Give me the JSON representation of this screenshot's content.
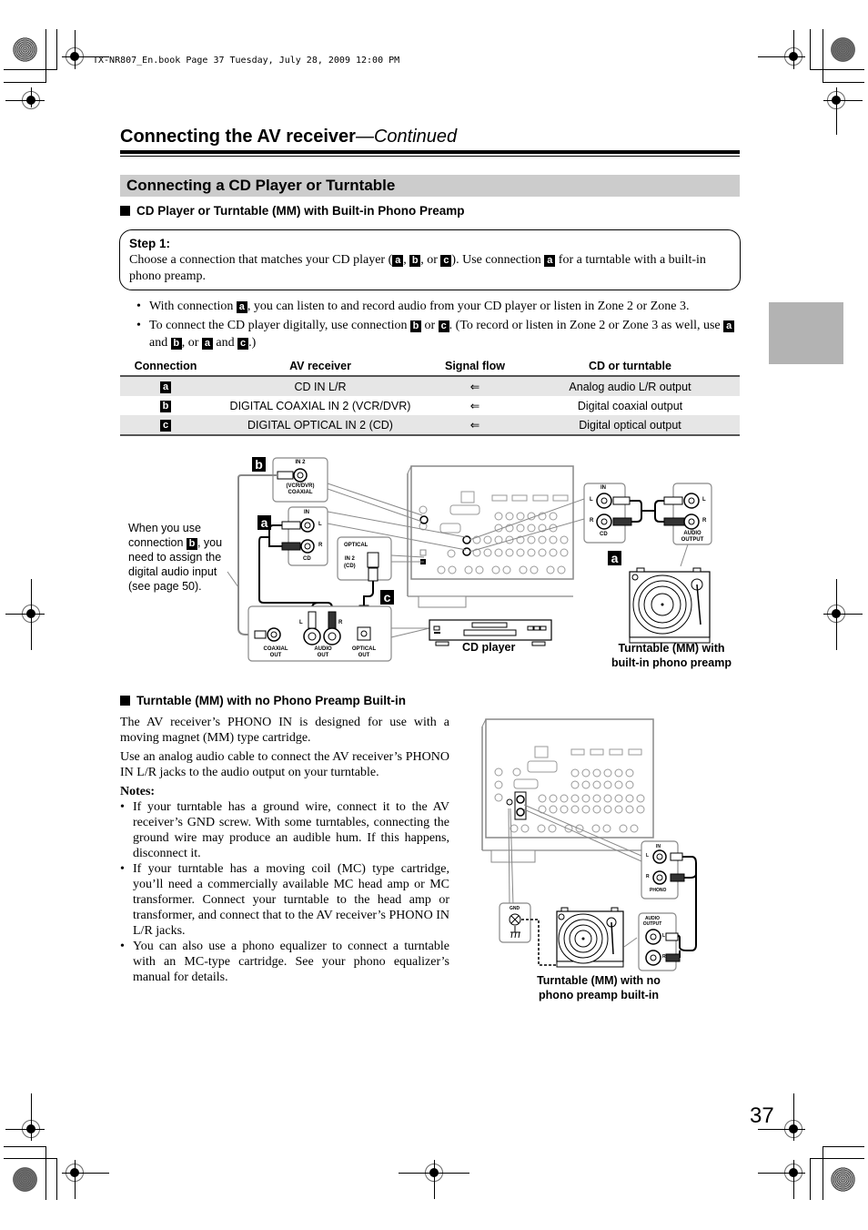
{
  "print_header": "TX-NR807_En.book  Page 37  Tuesday, July 28, 2009  12:00 PM",
  "page_title": {
    "main": "Connecting the AV receiver",
    "suffix": "—Continued"
  },
  "section_title": "Connecting a CD Player or Turntable",
  "subsection1": {
    "heading": "CD Player or Turntable (MM) with Built-in Phono Preamp",
    "step": {
      "label": "Step 1:",
      "text_parts": [
        "Choose a connection that matches your CD player (",
        ", ",
        ", or ",
        "). Use connection ",
        " for a turntable with a built-in phono preamp."
      ],
      "badges": [
        "a",
        "b",
        "c",
        "a"
      ]
    },
    "bullets": [
      {
        "parts": [
          "With connection ",
          ", you can listen to and record audio from your CD player or listen in Zone 2 or Zone 3."
        ],
        "badges": [
          "a"
        ]
      },
      {
        "parts": [
          "To connect the CD player digitally, use connection ",
          " or ",
          ". (To record or listen in Zone 2 or Zone 3 as well, use ",
          " and ",
          ", or ",
          " and ",
          ".)"
        ],
        "badges": [
          "b",
          "c",
          "a",
          "b",
          "a",
          "c"
        ]
      }
    ],
    "table": {
      "headers": [
        "Connection",
        "AV receiver",
        "Signal flow",
        "CD or turntable"
      ],
      "rows": [
        {
          "connection": "a",
          "receiver": "CD IN L/R",
          "flow": "⇐",
          "device": "Analog audio L/R output"
        },
        {
          "connection": "b",
          "receiver": "DIGITAL COAXIAL IN 2 (VCR/DVR)",
          "flow": "⇐",
          "device": "Digital coaxial output"
        },
        {
          "connection": "c",
          "receiver": "DIGITAL OPTICAL IN 2 (CD)",
          "flow": "⇐",
          "device": "Digital optical output"
        }
      ]
    },
    "diagram": {
      "callout": [
        "When you use",
        "connection ",
        ", you",
        "need to assign the",
        "digital audio input",
        "(see page 50)."
      ],
      "callout_badge": "b",
      "badges": {
        "b": "b",
        "a": "a",
        "c": "c",
        "a2": "a"
      },
      "coax_in_label1": "IN 2",
      "coax_in_label2": "(VCR/DVR)",
      "coax_in_label3": "COAXIAL",
      "cd_in_top": "IN",
      "cd_in_bottom": "CD",
      "left": "L",
      "right": "R",
      "optical_label": "OPTICAL",
      "optical_in1": "IN 2",
      "optical_in2": "(CD)",
      "coaxial_out1": "COAXIAL",
      "coaxial_out2": "OUT",
      "audio_out1": "AUDIO",
      "audio_out2": "OUT",
      "optical_out1": "OPTICAL",
      "optical_out2": "OUT",
      "right_in_top": "IN",
      "right_in_bottom": "CD",
      "audio_output1": "AUDIO",
      "audio_output2": "OUTPUT",
      "cd_player_caption": "CD player",
      "turntable_caption1": "Turntable (MM) with",
      "turntable_caption2": "built-in phono preamp"
    }
  },
  "subsection2": {
    "heading": "Turntable (MM) with no Phono Preamp Built-in",
    "paragraphs": [
      "The AV receiver’s PHONO IN is designed for use with a moving magnet (MM) type cartridge.",
      "Use an analog audio cable to connect the AV receiver’s PHONO IN L/R jacks to the audio output on your turntable."
    ],
    "notes_title": "Notes:",
    "notes": [
      "If your turntable has a ground wire, connect it to the AV receiver’s GND screw. With some turntables, connecting the ground wire may produce an audible hum. If this happens, disconnect it.",
      "If your turntable has a moving coil (MC) type cartridge, you’ll need a commercially available MC head amp or MC transformer. Connect your turntable to the head amp or transformer, and connect that to the AV receiver’s PHONO IN L/R jacks.",
      "You can also use a phono equalizer to connect a turntable with an MC-type cartridge. See your phono equalizer’s manual for details."
    ],
    "diagram": {
      "phono_in_top": "IN",
      "phono_in_bottom": "PHONO",
      "left": "L",
      "right": "R",
      "gnd_label": "GND",
      "audio_output1": "AUDIO",
      "audio_output2": "OUTPUT",
      "caption1": "Turntable (MM) with no",
      "caption2": "phono preamp built-in"
    }
  },
  "page_number": "37"
}
